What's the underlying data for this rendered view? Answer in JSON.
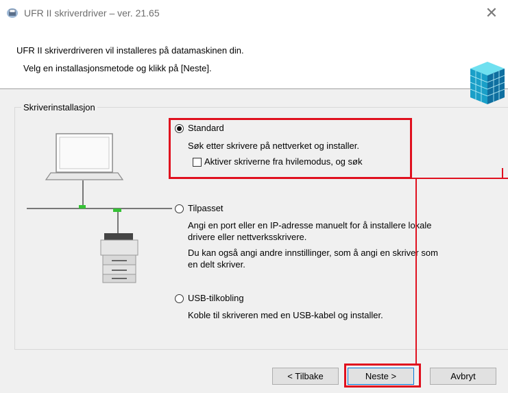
{
  "window": {
    "title": "UFR II skriverdriver – ver. 21.65"
  },
  "header": {
    "line1": "UFR II skriverdriveren vil installeres på datamaskinen din.",
    "line2": "Velg en installasjonsmetode og klikk på [Neste]."
  },
  "group": {
    "label": "Skriverinstallasjon"
  },
  "options": {
    "standard": {
      "label": "Standard",
      "selected": true,
      "desc": "Søk etter skrivere på nettverket og installer.",
      "checkbox_label": "Aktiver skriverne fra hvilemodus, og søk",
      "checkbox_checked": false
    },
    "custom": {
      "label": "Tilpasset",
      "selected": false,
      "desc1": "Angi en port eller en IP-adresse manuelt for å installere lokale",
      "desc2": "drivere eller nettverksskrivere.",
      "desc3": "Du kan også angi andre innstillinger, som å angi en skriver som",
      "desc4": "en delt skriver."
    },
    "usb": {
      "label": "USB-tilkobling",
      "selected": false,
      "desc": "Koble til skriveren med en USB-kabel og installer."
    }
  },
  "buttons": {
    "back": "< Tilbake",
    "next": "Neste >",
    "cancel": "Avbryt"
  },
  "colors": {
    "highlight": "#e0101e",
    "network_port": "#35c235"
  }
}
